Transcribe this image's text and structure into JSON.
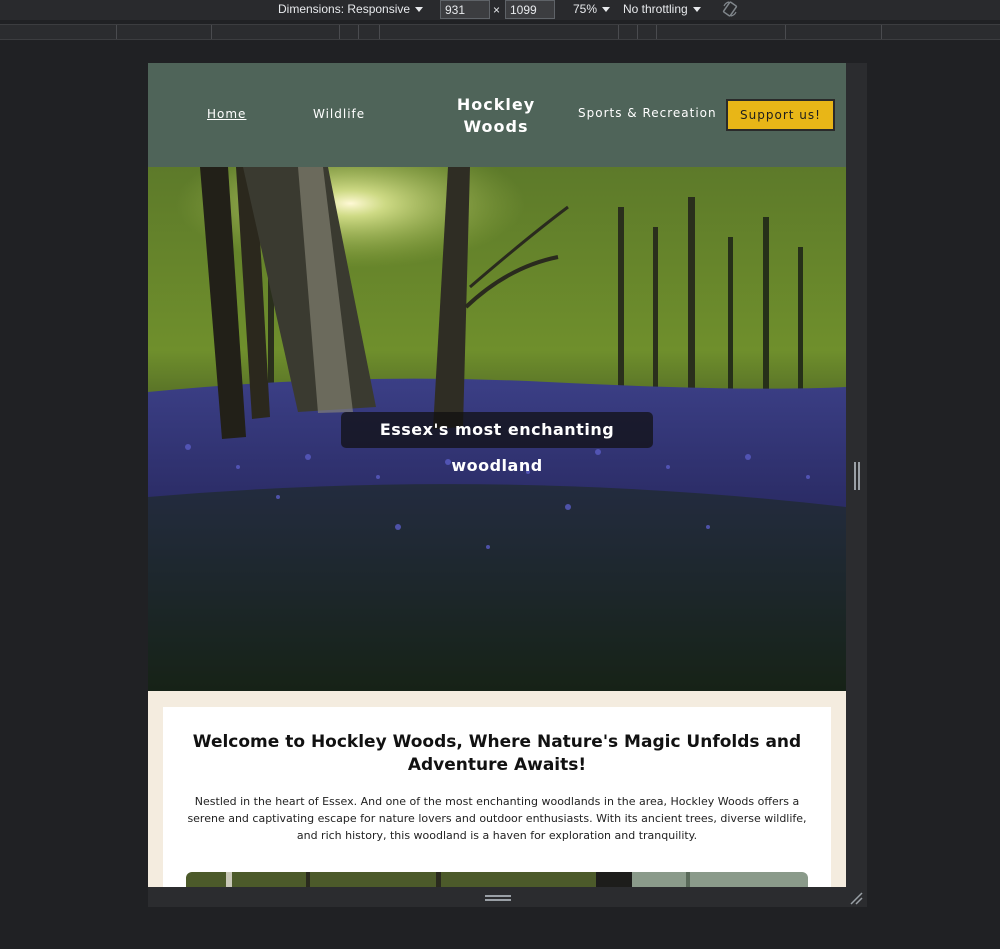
{
  "devtools": {
    "dimensions_label": "Dimensions: Responsive",
    "width_value": "931",
    "times_symbol": "×",
    "height_value": "1099",
    "zoom": "75%",
    "throttling": "No throttling"
  },
  "site": {
    "nav": {
      "home": "Home",
      "wildlife": "Wildlife",
      "brand_line1": "Hockley",
      "brand_line2": "Woods",
      "sports": "Sports & Recreation",
      "support_button": "Support us!"
    },
    "hero": {
      "caption": "Essex's most enchanting woodland"
    },
    "welcome": {
      "heading": "Welcome to Hockley Woods, Where Nature's Magic Unfolds and Adventure Awaits!",
      "body": "Nestled in the heart of Essex. And one of the most enchanting woodlands in the area, Hockley Woods offers a serene and captivating escape for nature lovers and outdoor enthusiasts. With its ancient trees, diverse wildlife, and rich history, this woodland is a haven for exploration and tranquility."
    }
  },
  "colors": {
    "nav_bg": "#4f6459",
    "support_bg": "#e8b617",
    "page_bg": "#f4ecdf",
    "devtools_bg": "#202124"
  }
}
